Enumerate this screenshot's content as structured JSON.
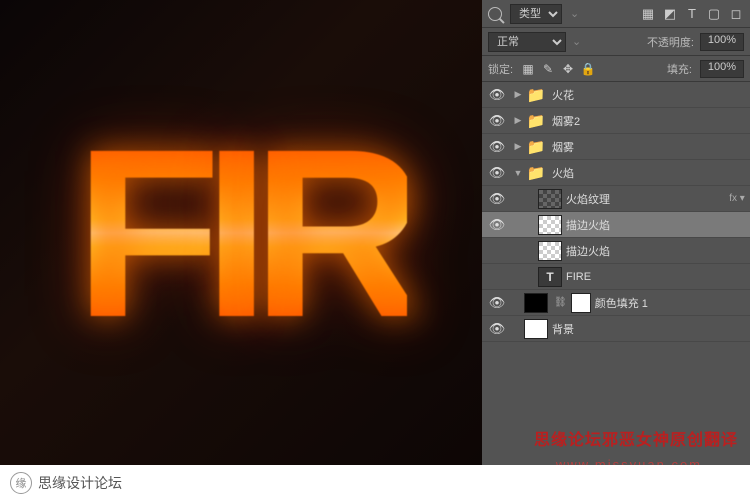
{
  "canvas": {
    "text": "FIR"
  },
  "topbar": {
    "filter_label": "类型",
    "icons": [
      "▦",
      "◩",
      "T",
      "▢",
      "◻"
    ]
  },
  "blend": {
    "mode": "正常",
    "opacity_label": "不透明度:",
    "opacity_value": "100%"
  },
  "lock": {
    "label": "锁定:",
    "fill_label": "填充:",
    "fill_value": "100%",
    "icons": [
      "▦",
      "✎",
      "✥",
      "🔒"
    ]
  },
  "layers": [
    {
      "vis": true,
      "type": "group",
      "indent": 0,
      "name": "火花"
    },
    {
      "vis": true,
      "type": "group",
      "indent": 0,
      "name": "烟雾2"
    },
    {
      "vis": true,
      "type": "group",
      "indent": 0,
      "name": "烟雾"
    },
    {
      "vis": true,
      "type": "group",
      "indent": 0,
      "open": true,
      "name": "火焰"
    },
    {
      "vis": true,
      "type": "tex",
      "indent": 1,
      "name": "火焰纹理",
      "fx": true
    },
    {
      "vis": true,
      "type": "checker",
      "indent": 1,
      "name": "描边火焰",
      "selected": true
    },
    {
      "vis": false,
      "type": "checker",
      "indent": 1,
      "name": "描边火焰"
    },
    {
      "vis": false,
      "type": "text",
      "indent": 1,
      "name": "FIRE"
    },
    {
      "vis": true,
      "type": "fill",
      "indent": 0,
      "name": "颜色填充 1",
      "hasMask": true
    },
    {
      "vis": true,
      "type": "white",
      "indent": 0,
      "name": "背景"
    }
  ],
  "watermark": {
    "line1": "思缘论坛邪恶女神原创翻译",
    "line2": "www.missyuan.com"
  },
  "footer": {
    "text": "思缘设计论坛"
  }
}
